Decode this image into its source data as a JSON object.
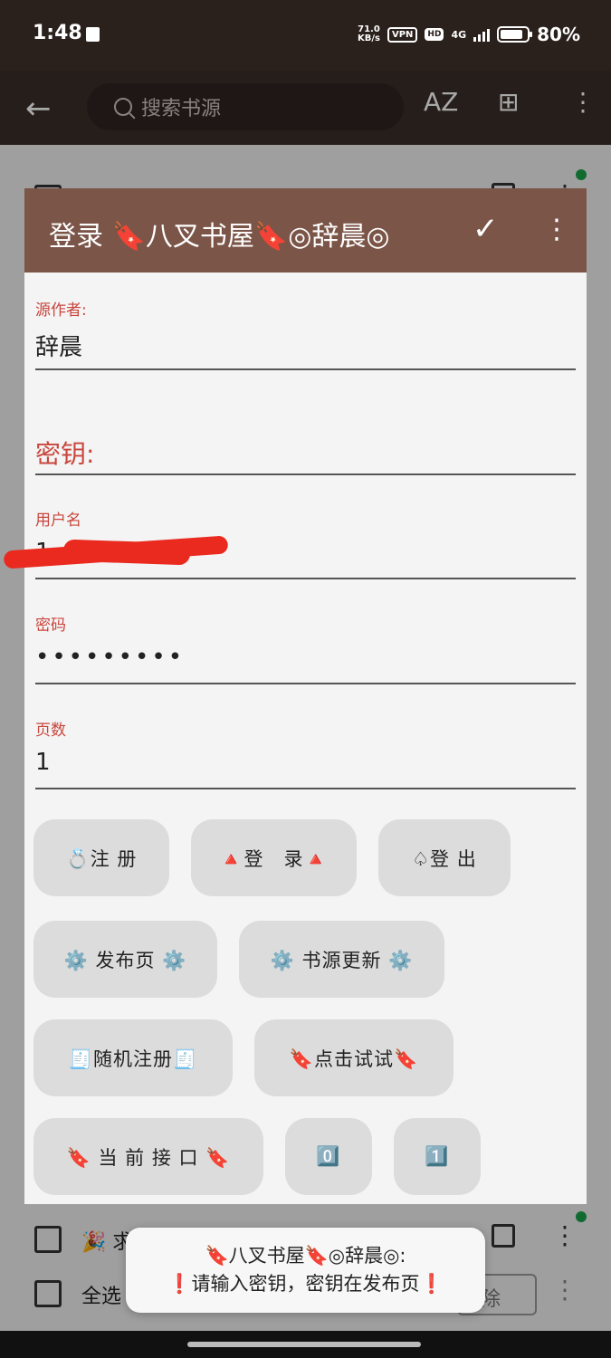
{
  "status_bar": {
    "time": "1:48",
    "speed_top": "71.0",
    "speed_bottom": "KB/s",
    "vpn": "VPN",
    "hd": "HD",
    "network": "4G",
    "battery_percent": "80%",
    "battery_level": 0.8
  },
  "toolbar": {
    "search_placeholder": "搜索书源",
    "sort_label": "AZ"
  },
  "background_list": {
    "row_bottom_text": "求",
    "select_all_label": "全选",
    "delete_label": "除"
  },
  "dialog": {
    "title": "登录 🔖八叉书屋🔖◎辞晨◎",
    "fields": {
      "author_label": "源作者:",
      "author_value": "辞晨",
      "key_label": "密钥:",
      "username_label": "用户名",
      "username_value": "1",
      "password_label": "密码",
      "password_value": "•••••••••",
      "pages_label": "页数",
      "pages_value": "1"
    },
    "buttons": {
      "register": "💍注 册",
      "login": "🔺登　录🔺",
      "logout": "♤登 出",
      "publish_page": "⚙️ 发布页 ⚙️",
      "source_update": "⚙️ 书源更新 ⚙️",
      "random_register": "🧾随机注册🧾",
      "try_click": "🔖点击试试🔖",
      "current_api": "🔖 当 前 接 口 🔖",
      "zero": "0️⃣",
      "one": "1️⃣"
    }
  },
  "toast": {
    "line1": "🔖八叉书屋🔖◎辞晨◎:",
    "line2": "❗请输入密钥，密钥在发布页❗"
  }
}
